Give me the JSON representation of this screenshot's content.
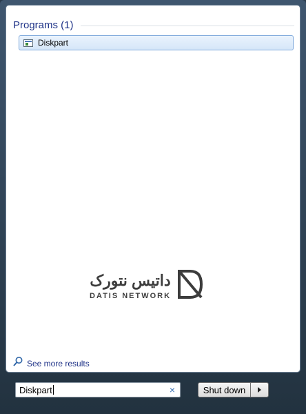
{
  "results": {
    "group_title": "Programs (1)",
    "items": [
      {
        "label": "Diskpart",
        "icon": "console-app-icon"
      }
    ]
  },
  "watermark": {
    "persian": "داتیس نتورک",
    "latin": "DATIS NETWORK"
  },
  "see_more": {
    "label": "See more results",
    "icon": "magnifier-icon"
  },
  "search": {
    "value": "Diskpart",
    "clear_icon": "×"
  },
  "power": {
    "shutdown_label": "Shut down",
    "options_icon": "triangle-right-icon"
  },
  "colors": {
    "frame": "#2e4256",
    "group_title": "#1e3287",
    "selection_border": "#84acdd",
    "link": "#1e3287"
  }
}
